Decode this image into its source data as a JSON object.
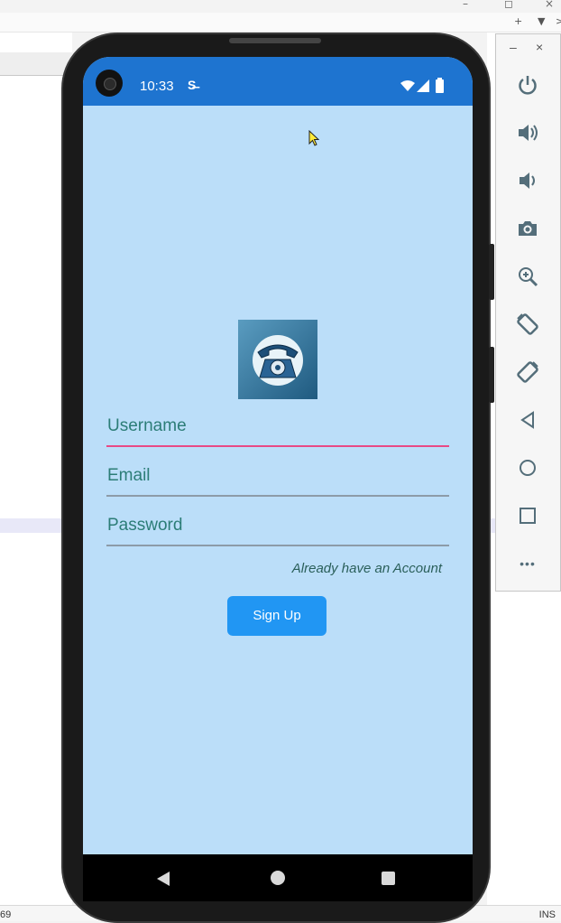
{
  "ide": {
    "window_controls": {
      "minimize": "–",
      "restore": "◻",
      "close": "×"
    },
    "strip_controls": {
      "add": "+",
      "menu": "▼",
      "more": ">"
    },
    "status_left": "69",
    "status_right": "INS"
  },
  "phone": {
    "status_bar": {
      "time": "10:33",
      "sim_icon": "S̶"
    },
    "colors": {
      "status_bar": "#1e74d0",
      "background": "#bbdef9",
      "button": "#2196f3",
      "focused_line": "#e84a86"
    },
    "form": {
      "logo": "telephone-logo",
      "username_label": "Username",
      "email_label": "Email",
      "password_label": "Password",
      "already_link": "Already have an Account",
      "signup_button": "Sign Up",
      "focused_field": "username"
    },
    "nav": {
      "back": "back-icon",
      "home": "home-icon",
      "recent": "recent-apps-icon"
    }
  },
  "emulator_toolbar": {
    "minimize": "–",
    "close": "×",
    "buttons": [
      "power-icon",
      "volume-up-icon",
      "volume-down-icon",
      "camera-icon",
      "zoom-icon",
      "rotate-left-icon",
      "rotate-right-icon",
      "back-icon",
      "home-icon",
      "overview-icon",
      "more-icon"
    ],
    "more_label": "•••"
  }
}
